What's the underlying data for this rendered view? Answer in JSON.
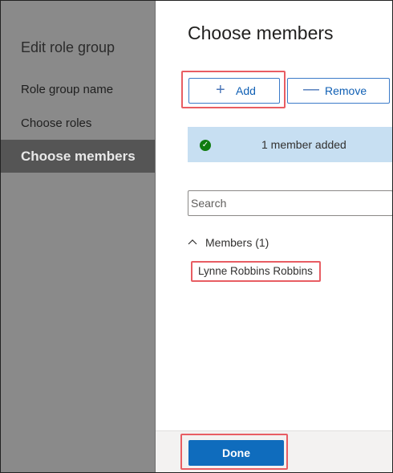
{
  "sidebar": {
    "title": "Edit role group",
    "items": [
      {
        "label": "Role group name"
      },
      {
        "label": "Choose roles"
      },
      {
        "label": "Choose members"
      }
    ]
  },
  "main": {
    "title": "Choose members",
    "add_label": "Add",
    "remove_label": "Remove",
    "banner_message": "1 member added",
    "search_placeholder": "Search",
    "members_header": "Members (1)",
    "members": [
      "Lynne Robbins Robbins"
    ]
  },
  "footer": {
    "done_label": "Done"
  },
  "colors": {
    "accent": "#0f6cbd",
    "highlight": "#e85d63",
    "banner": "#c7dff2",
    "success": "#107c10"
  },
  "icons": {
    "add": "plus-icon",
    "remove": "minus-icon",
    "banner": "check-circle-icon",
    "members": "chevron-up-icon"
  }
}
